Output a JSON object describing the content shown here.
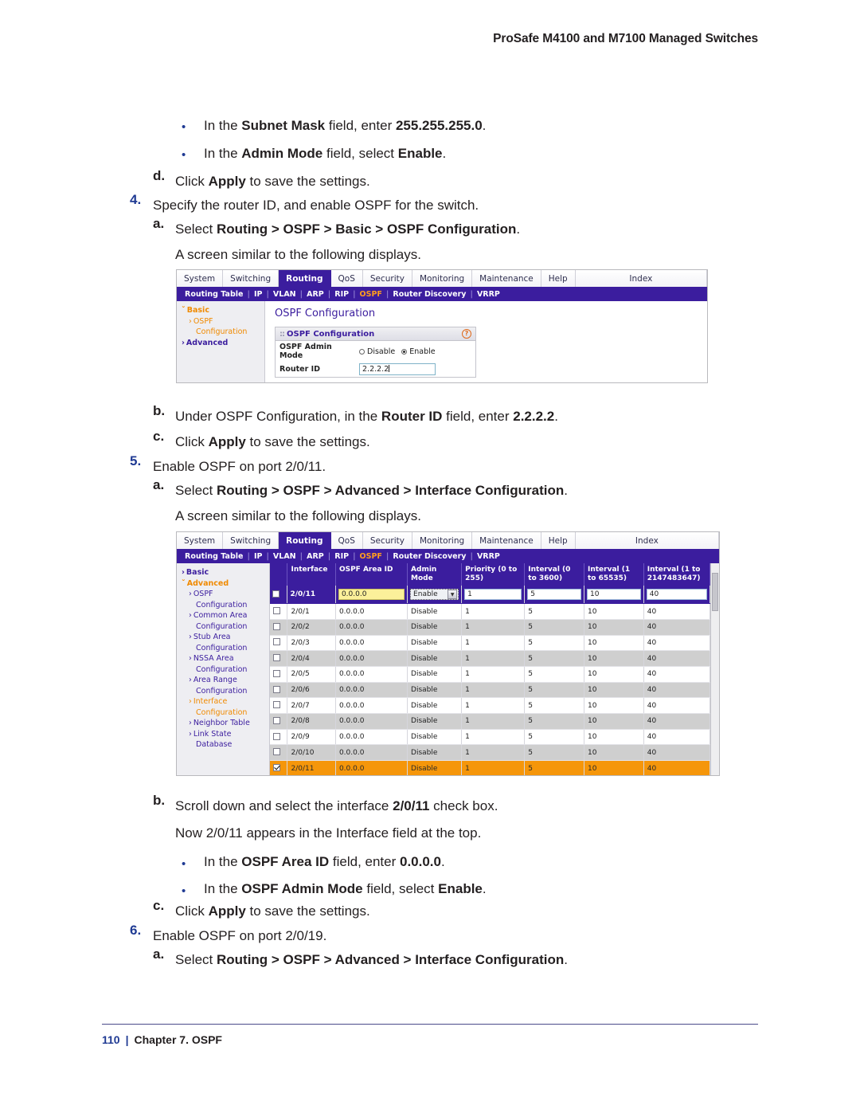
{
  "document": {
    "running_header": "ProSafe M4100 and M7100 Managed Switches",
    "footer_page": "110",
    "footer_sep": "|",
    "footer_chapter": "Chapter 7. OSPF"
  },
  "steps": {
    "b1_bullet": "•",
    "b1_a": "In the ",
    "b1_b1": "Subnet Mask",
    "b1_c": " field, enter ",
    "b1_b2": "255.255.255.0",
    "b1_d": ".",
    "b2_bullet": "•",
    "b2_a": "In the ",
    "b2_b1": "Admin Mode",
    "b2_c": " field, select ",
    "b2_b2": "Enable",
    "b2_d": ".",
    "d_marker": "d.",
    "d_a": "Click ",
    "d_b": "Apply",
    "d_c": " to save the settings.",
    "s4_marker": "4.",
    "s4_text": "Specify the router ID, and enable OSPF for the switch.",
    "s4a_marker": "a.",
    "s4a_a": "Select ",
    "s4a_b": "Routing > OSPF > Basic > OSPF Configuration",
    "s4a_c": ".",
    "s4a_note": "A screen similar to the following displays.",
    "s4b_marker": "b.",
    "s4b_a": "Under OSPF Configuration, in the ",
    "s4b_b1": "Router ID",
    "s4b_c": " field, enter ",
    "s4b_b2": "2.2.2.2",
    "s4b_d": ".",
    "s4c_marker": "c.",
    "s4c_a": "Click ",
    "s4c_b": "Apply",
    "s4c_c": " to save the settings.",
    "s5_marker": "5.",
    "s5_text": "Enable OSPF on port 2/0/11.",
    "s5a_marker": "a.",
    "s5a_a": "Select ",
    "s5a_b": "Routing > OSPF > Advanced > Interface Configuration",
    "s5a_c": ".",
    "s5a_note": "A screen similar to the following displays.",
    "s5b_marker": "b.",
    "s5b_a": "Scroll down and select the interface ",
    "s5b_b": "2/0/11",
    "s5b_c": " check box.",
    "s5b_note": "Now 2/0/11 appears in the Interface field at the top.",
    "s5b1_bullet": "•",
    "s5b1_a": "In the ",
    "s5b1_b1": "OSPF Area ID",
    "s5b1_c": " field, enter ",
    "s5b1_b2": "0.0.0.0",
    "s5b1_d": ".",
    "s5b2_bullet": "•",
    "s5b2_a": "In the ",
    "s5b2_b1": "OSPF Admin Mode",
    "s5b2_c": " field, select ",
    "s5b2_b2": "Enable",
    "s5b2_d": ".",
    "s5c_marker": "c.",
    "s5c_a": "Click ",
    "s5c_b": "Apply",
    "s5c_c": " to save the settings.",
    "s6_marker": "6.",
    "s6_text": "Enable OSPF on port 2/0/19.",
    "s6a_marker": "a.",
    "s6a_a": "Select ",
    "s6a_b": "Routing > OSPF > Advanced > Interface Configuration",
    "s6a_c": "."
  },
  "ui_common": {
    "tabs": [
      "System",
      "Switching",
      "Routing",
      "QoS",
      "Security",
      "Monitoring",
      "Maintenance",
      "Help",
      "Index"
    ],
    "active_tab": "Routing",
    "subnav": [
      "Routing Table",
      "IP",
      "VLAN",
      "ARP",
      "RIP",
      "OSPF",
      "Router Discovery",
      "VRRP"
    ],
    "subnav_selected": "OSPF",
    "subnav_sep": "|",
    "colors": {
      "purple": "#3b1d9e",
      "orange": "#f08a00",
      "row_selected": "#f5960a",
      "row_alt": "#cfcfcf",
      "input_yellow": "#fbf09a"
    }
  },
  "screenshot_basic": {
    "sidebar": [
      {
        "label": "Basic",
        "level": 1,
        "caret": "ˇ",
        "style": "orange-b"
      },
      {
        "label": "OSPF",
        "level": 2,
        "caret": "›",
        "style": "orange"
      },
      {
        "label": "Configuration",
        "level": 3,
        "caret": "",
        "style": "orange"
      },
      {
        "label": "Advanced",
        "level": 1,
        "caret": "›",
        "style": "purple-b"
      }
    ],
    "page_title": "OSPF Configuration",
    "panel_title": "OSPF Configuration",
    "panel_dots": "::",
    "help_icon": "?",
    "fields": [
      {
        "label": "OSPF Admin Mode",
        "type": "radio",
        "options": [
          "Disable",
          "Enable"
        ],
        "selected": "Enable"
      },
      {
        "label": "Router ID",
        "type": "text",
        "value": "2.2.2.2"
      }
    ]
  },
  "screenshot_interface": {
    "sidebar": [
      {
        "label": "Basic",
        "level": 1,
        "caret": "›",
        "style": "purple-b"
      },
      {
        "label": "Advanced",
        "level": 1,
        "caret": "ˇ",
        "style": "orange-b"
      },
      {
        "label": "OSPF",
        "level": 2,
        "caret": "›",
        "style": "purple"
      },
      {
        "label": "Configuration",
        "level": 3,
        "caret": "",
        "style": "purple"
      },
      {
        "label": "Common Area",
        "level": 2,
        "caret": "›",
        "style": "purple"
      },
      {
        "label": "Configuration",
        "level": 3,
        "caret": "",
        "style": "purple"
      },
      {
        "label": "Stub Area",
        "level": 2,
        "caret": "›",
        "style": "purple"
      },
      {
        "label": "Configuration",
        "level": 3,
        "caret": "",
        "style": "purple"
      },
      {
        "label": "NSSA Area",
        "level": 2,
        "caret": "›",
        "style": "purple"
      },
      {
        "label": "Configuration",
        "level": 3,
        "caret": "",
        "style": "purple"
      },
      {
        "label": "Area Range",
        "level": 2,
        "caret": "›",
        "style": "purple"
      },
      {
        "label": "Configuration",
        "level": 3,
        "caret": "",
        "style": "purple"
      },
      {
        "label": "Interface",
        "level": 2,
        "caret": "›",
        "style": "orange"
      },
      {
        "label": "Configuration",
        "level": 3,
        "caret": "",
        "style": "orange"
      },
      {
        "label": "Neighbor Table",
        "level": 2,
        "caret": "›",
        "style": "purple"
      },
      {
        "label": "Link State",
        "level": 2,
        "caret": "›",
        "style": "purple"
      },
      {
        "label": "Database",
        "level": 3,
        "caret": "",
        "style": "purple"
      }
    ],
    "table": {
      "columns": [
        "",
        "Interface",
        "OSPF Area ID",
        "Admin Mode",
        "Priority (0 to 255)",
        "Interval (0 to 3600)",
        "Interval (1 to 65535)",
        "Interval (1 to 2147483647)"
      ],
      "edit_row": {
        "checked": false,
        "interface": "2/0/11",
        "area_id": "0.0.0.0",
        "admin_mode": "Enable",
        "admin_mode_arrow": "▼",
        "priority": "1",
        "interval_0_3600": "5",
        "interval_1_65535": "10",
        "interval_1_2147483647": "40"
      },
      "rows": [
        {
          "checked": false,
          "interface": "2/0/1",
          "area_id": "0.0.0.0",
          "admin_mode": "Disable",
          "priority": "1",
          "interval_0_3600": "5",
          "interval_1_65535": "10",
          "interval_1_2147483647": "40",
          "selected": false
        },
        {
          "checked": false,
          "interface": "2/0/2",
          "area_id": "0.0.0.0",
          "admin_mode": "Disable",
          "priority": "1",
          "interval_0_3600": "5",
          "interval_1_65535": "10",
          "interval_1_2147483647": "40",
          "selected": false
        },
        {
          "checked": false,
          "interface": "2/0/3",
          "area_id": "0.0.0.0",
          "admin_mode": "Disable",
          "priority": "1",
          "interval_0_3600": "5",
          "interval_1_65535": "10",
          "interval_1_2147483647": "40",
          "selected": false
        },
        {
          "checked": false,
          "interface": "2/0/4",
          "area_id": "0.0.0.0",
          "admin_mode": "Disable",
          "priority": "1",
          "interval_0_3600": "5",
          "interval_1_65535": "10",
          "interval_1_2147483647": "40",
          "selected": false
        },
        {
          "checked": false,
          "interface": "2/0/5",
          "area_id": "0.0.0.0",
          "admin_mode": "Disable",
          "priority": "1",
          "interval_0_3600": "5",
          "interval_1_65535": "10",
          "interval_1_2147483647": "40",
          "selected": false
        },
        {
          "checked": false,
          "interface": "2/0/6",
          "area_id": "0.0.0.0",
          "admin_mode": "Disable",
          "priority": "1",
          "interval_0_3600": "5",
          "interval_1_65535": "10",
          "interval_1_2147483647": "40",
          "selected": false
        },
        {
          "checked": false,
          "interface": "2/0/7",
          "area_id": "0.0.0.0",
          "admin_mode": "Disable",
          "priority": "1",
          "interval_0_3600": "5",
          "interval_1_65535": "10",
          "interval_1_2147483647": "40",
          "selected": false
        },
        {
          "checked": false,
          "interface": "2/0/8",
          "area_id": "0.0.0.0",
          "admin_mode": "Disable",
          "priority": "1",
          "interval_0_3600": "5",
          "interval_1_65535": "10",
          "interval_1_2147483647": "40",
          "selected": false
        },
        {
          "checked": false,
          "interface": "2/0/9",
          "area_id": "0.0.0.0",
          "admin_mode": "Disable",
          "priority": "1",
          "interval_0_3600": "5",
          "interval_1_65535": "10",
          "interval_1_2147483647": "40",
          "selected": false
        },
        {
          "checked": false,
          "interface": "2/0/10",
          "area_id": "0.0.0.0",
          "admin_mode": "Disable",
          "priority": "1",
          "interval_0_3600": "5",
          "interval_1_65535": "10",
          "interval_1_2147483647": "40",
          "selected": false
        },
        {
          "checked": true,
          "interface": "2/0/11",
          "area_id": "0.0.0.0",
          "admin_mode": "Disable",
          "priority": "1",
          "interval_0_3600": "5",
          "interval_1_65535": "10",
          "interval_1_2147483647": "40",
          "selected": true
        }
      ]
    }
  }
}
